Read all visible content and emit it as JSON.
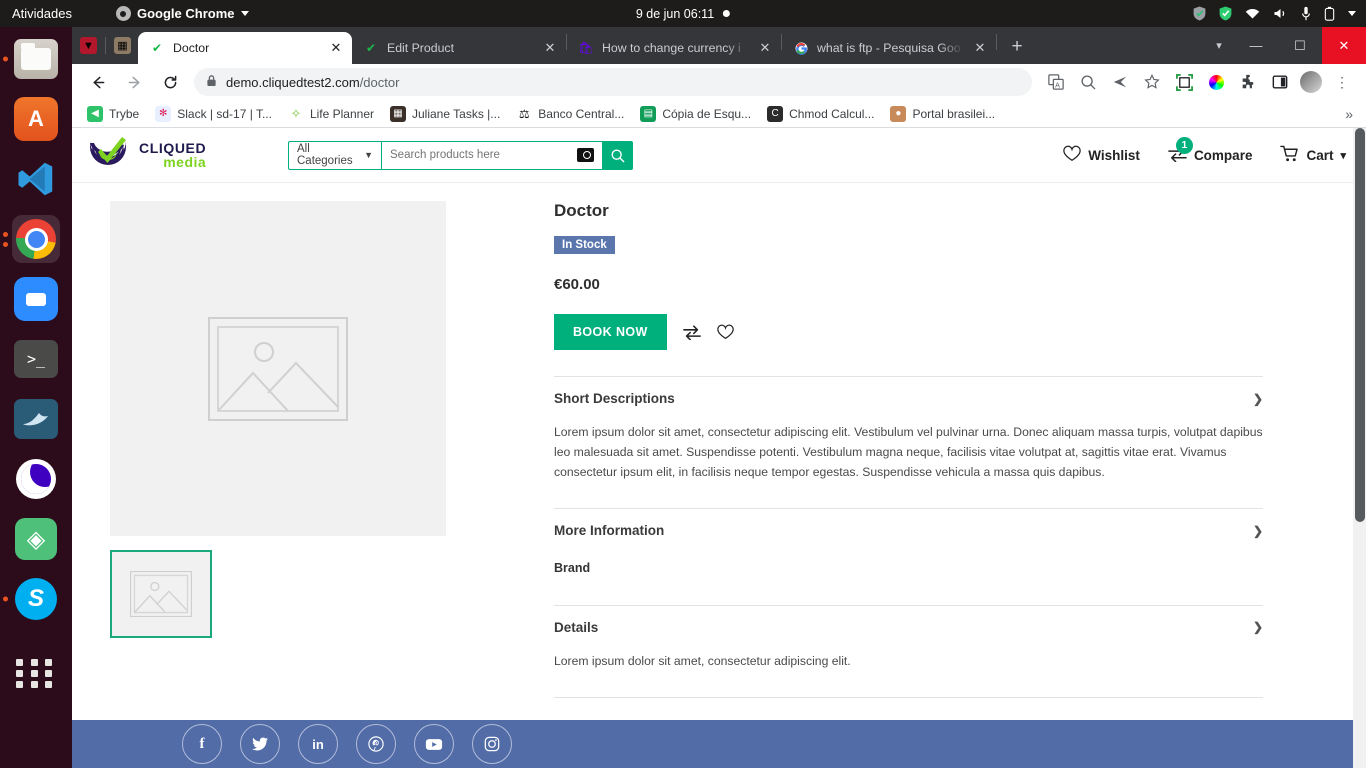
{
  "os": {
    "activities": "Atividades",
    "app_menu": "Google Chrome",
    "clock": "9 de jun  06:11",
    "tray_icons": [
      "shield-icon",
      "check-shield-icon",
      "wifi-icon",
      "volume-icon",
      "microphone-icon",
      "battery-icon",
      "chevron-down-icon"
    ],
    "dock_items": [
      {
        "name": "files",
        "label": ""
      },
      {
        "name": "ubuntu-software",
        "label": "A"
      },
      {
        "name": "vscode",
        "label": "X"
      },
      {
        "name": "google-chrome",
        "label": ""
      },
      {
        "name": "zoom",
        "label": ""
      },
      {
        "name": "terminal",
        "label": ">_"
      },
      {
        "name": "mysql-workbench",
        "label": "ʃ"
      },
      {
        "name": "insomnia",
        "label": ""
      },
      {
        "name": "green-app",
        "label": "◈"
      },
      {
        "name": "skype",
        "label": "S"
      },
      {
        "name": "show-applications",
        "label": ""
      }
    ]
  },
  "browser": {
    "tabs": [
      {
        "title": "Doctor",
        "favicon": "green-check-icon",
        "active": true
      },
      {
        "title": "Edit Product",
        "favicon": "green-check-icon",
        "active": false
      },
      {
        "title": "How to change currency i",
        "favicon": "purple-bag-icon",
        "active": false
      },
      {
        "title": "what is ftp - Pesquisa Goo",
        "favicon": "google-icon",
        "active": false
      }
    ],
    "new_tab_label": "+",
    "window_controls": {
      "minimize": "—",
      "maximize": "❐",
      "close": "✕",
      "chevron": "▾"
    },
    "nav": {
      "back": "←",
      "forward": "→",
      "reload": "⟳"
    },
    "omnibox": {
      "lock": "lock-icon",
      "host": "demo.cliquedtest2.com",
      "path": "/doctor"
    },
    "toolbar_icons": [
      "translate-icon",
      "zoom-out-icon",
      "send-icon",
      "bookmark-star-icon",
      "capture-icon",
      "color-wheel-icon",
      "extensions-puzzle-icon",
      "sidepanel-icon",
      "profile-avatar",
      "kebab-menu-icon"
    ],
    "bookmarks": [
      {
        "label": "Trybe",
        "icon": "trybe-icon",
        "color": "#2ec26a"
      },
      {
        "label": "Slack | sd-17 | T...",
        "icon": "slack-icon",
        "color": "#e01e5a"
      },
      {
        "label": "Life Planner",
        "icon": "leaf-icon",
        "color": "#7cc442"
      },
      {
        "label": "Juliane Tasks |...",
        "icon": "notion-icon",
        "color": "#3b2f2a"
      },
      {
        "label": "Banco Central...",
        "icon": "bacen-icon",
        "color": "#1c1c1c"
      },
      {
        "label": "Cópia de Esqu...",
        "icon": "sheets-icon",
        "color": "#0f9d58"
      },
      {
        "label": "Chmod Calcul...",
        "icon": "chmod-icon",
        "color": "#2b2b2b"
      },
      {
        "label": "Portal brasilei...",
        "icon": "portal-icon",
        "color": "#b5651d"
      }
    ],
    "bookmarks_overflow": "»"
  },
  "site": {
    "logo": {
      "line1": "CLIQUED",
      "line2": "media"
    },
    "search": {
      "category": "All Categories",
      "placeholder": "Search products here",
      "value": "",
      "camera_icon": "camera-icon",
      "submit_icon": "search-icon"
    },
    "actions": [
      {
        "label": "Wishlist",
        "icon": "heart-icon",
        "badge": ""
      },
      {
        "label": "Compare",
        "icon": "compare-icon",
        "badge": "1"
      },
      {
        "label": "Cart",
        "icon": "cart-icon",
        "badge": "",
        "chevron": "⌄"
      }
    ],
    "colors": {
      "accent_green": "#00b07c",
      "badge_blue": "#5b76ad",
      "footer_blue": "#526ca8",
      "logo_green": "#7ed321"
    }
  },
  "product": {
    "title": "Doctor",
    "stock_status": "In Stock",
    "price": "€60.00",
    "book_button": "BOOK NOW",
    "compare_icon": "compare-icon",
    "wishlist_icon": "heart-icon",
    "sections": [
      {
        "heading": "Short Descriptions",
        "body": "Lorem ipsum dolor sit amet, consectetur adipiscing elit. Vestibulum vel pulvinar urna. Donec aliquam massa turpis, volutpat dapibus leo malesuada sit amet. Suspendisse potenti. Vestibulum magna neque, facilisis vitae volutpat at, sagittis vitae erat. Vivamus consectetur ipsum elit, in facilisis neque tempor egestas. Suspendisse vehicula a massa quis dapibus."
      },
      {
        "heading": "More Information",
        "body": "Brand"
      },
      {
        "heading": "Details",
        "body": "Lorem ipsum dolor sit amet, consectetur adipiscing elit."
      }
    ],
    "gallery": {
      "main_alt": "image-placeholder",
      "thumb_alt": "image-placeholder-thumb"
    }
  },
  "footer": {
    "social": [
      {
        "name": "facebook-icon",
        "glyph": "f"
      },
      {
        "name": "twitter-icon",
        "glyph": "ᵥ"
      },
      {
        "name": "linkedin-icon",
        "glyph": "in"
      },
      {
        "name": "pinterest-icon",
        "glyph": "Ⓟ"
      },
      {
        "name": "youtube-icon",
        "glyph": "▶"
      },
      {
        "name": "instagram-icon",
        "glyph": "▣"
      }
    ]
  }
}
